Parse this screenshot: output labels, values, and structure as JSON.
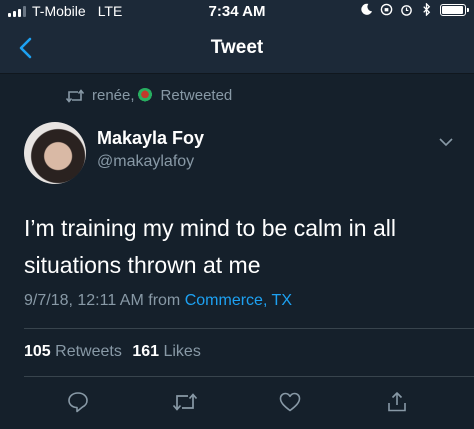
{
  "status_bar": {
    "carrier": "T-Mobile",
    "network": "LTE",
    "time": "7:34 AM",
    "battery_level": 0.95
  },
  "nav": {
    "title": "Tweet"
  },
  "retweet": {
    "user": "renée,",
    "label": "Retweeted"
  },
  "author": {
    "name": "Makayla Foy",
    "handle": "@makaylafoy"
  },
  "tweet": {
    "text": "I’m training my mind to be calm in all situations thrown at me",
    "date": "9/7/18, 12:11 AM",
    "from_label": "from",
    "location": "Commerce, TX"
  },
  "stats": {
    "retweets_count": "105",
    "retweets_label": "Retweets",
    "likes_count": "161",
    "likes_label": "Likes"
  },
  "colors": {
    "background": "#15202b",
    "bar": "#1c2938",
    "accent": "#1da1f2",
    "secondary_text": "#8899a6"
  },
  "icons": {
    "back": "chevron-left-icon",
    "retweet": "retweet-icon",
    "reply": "reply-icon",
    "like": "heart-icon",
    "share": "share-icon",
    "more": "chevron-down-icon"
  }
}
